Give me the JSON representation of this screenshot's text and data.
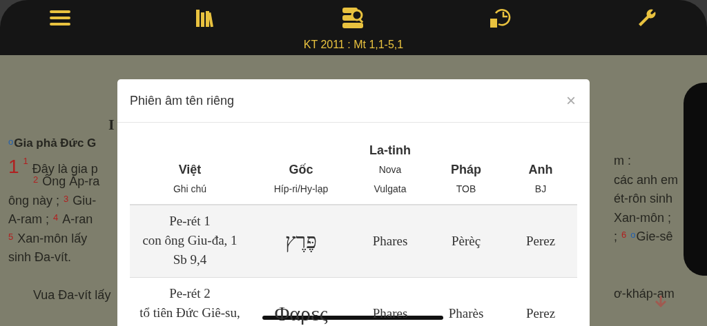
{
  "header": {
    "title": "KT 2011 : Mt 1,1-5,1"
  },
  "reader": {
    "left_lines": [
      [
        {
          "kind": "heading",
          "text": "I"
        }
      ],
      [
        {
          "kind": "note",
          "text": "o"
        },
        {
          "kind": "section",
          "text": "Gia phả Đức G"
        }
      ],
      [
        {
          "kind": "chapter",
          "text": "1"
        },
        {
          "kind": "verse",
          "text": "1"
        },
        {
          "kind": "text",
          "text": "Đây là gia p"
        }
      ],
      [
        {
          "kind": "indent"
        },
        {
          "kind": "verse",
          "text": "2"
        },
        {
          "kind": "text",
          "text": "Ông Áp-ra"
        }
      ],
      [
        {
          "kind": "text",
          "text": "ông này ;"
        },
        {
          "kind": "verse",
          "text": "3"
        },
        {
          "kind": "text",
          "text": "Giu-"
        }
      ],
      [
        {
          "kind": "text",
          "text": "A-ram ;"
        },
        {
          "kind": "verse",
          "text": "4"
        },
        {
          "kind": "text",
          "text": "A-ran"
        }
      ],
      [
        {
          "kind": "verse",
          "text": "5"
        },
        {
          "kind": "text",
          "text": "Xan-môn lấy"
        }
      ],
      [
        {
          "kind": "text",
          "text": "sinh Đa-vít."
        }
      ],
      [
        {
          "kind": "gap"
        }
      ],
      [
        {
          "kind": "indent"
        },
        {
          "kind": "text",
          "text": "Vua Đa-vít lấy"
        }
      ]
    ],
    "right_lines": [
      [
        {
          "kind": "gap"
        }
      ],
      [
        {
          "kind": "gap"
        }
      ],
      [
        {
          "kind": "text",
          "text": "m :"
        }
      ],
      [
        {
          "kind": "text",
          "text": "các anh em"
        }
      ],
      [
        {
          "kind": "text",
          "text": "ét-rôn sinh"
        }
      ],
      [
        {
          "kind": "text",
          "text": "Xan-môn ;"
        }
      ],
      [
        {
          "kind": "text",
          "text": ";"
        },
        {
          "kind": "verse",
          "text": "6"
        },
        {
          "kind": "note",
          "text": "o"
        },
        {
          "kind": "text",
          "text": "Gie-sê"
        }
      ],
      [
        {
          "kind": "gap"
        }
      ],
      [
        {
          "kind": "gap"
        }
      ],
      [
        {
          "kind": "text",
          "text": "ơ-kháp-am"
        }
      ]
    ]
  },
  "dialog": {
    "title": "Phiên âm tên riêng",
    "close": "×",
    "columns": [
      {
        "title": "Việt",
        "subtitle": [
          "Ghi chú"
        ]
      },
      {
        "title": "Gốc",
        "subtitle": [
          "Híp-ri/Hy-lạp"
        ]
      },
      {
        "title": "La-tinh",
        "subtitle": [
          "Nova",
          "Vulgata"
        ]
      },
      {
        "title": "Pháp",
        "subtitle": [
          "TOB"
        ]
      },
      {
        "title": "Anh",
        "subtitle": [
          "BJ"
        ]
      }
    ],
    "rows": [
      {
        "cells": [
          [
            "Pe-rét 1",
            "con ông Giu-đa, 1",
            "Sb 9,4"
          ],
          [
            "פֶּרֶץ"
          ],
          [
            "Phares"
          ],
          [
            "Pèrèç"
          ],
          [
            "Perez"
          ]
        ]
      },
      {
        "cells": [
          [
            "Pe-rét 2",
            "tổ tiên Đức Giê-su,"
          ],
          [
            "Φαρες"
          ],
          [
            "Phares"
          ],
          [
            "Pharès"
          ],
          [
            "Perez"
          ]
        ]
      }
    ]
  }
}
